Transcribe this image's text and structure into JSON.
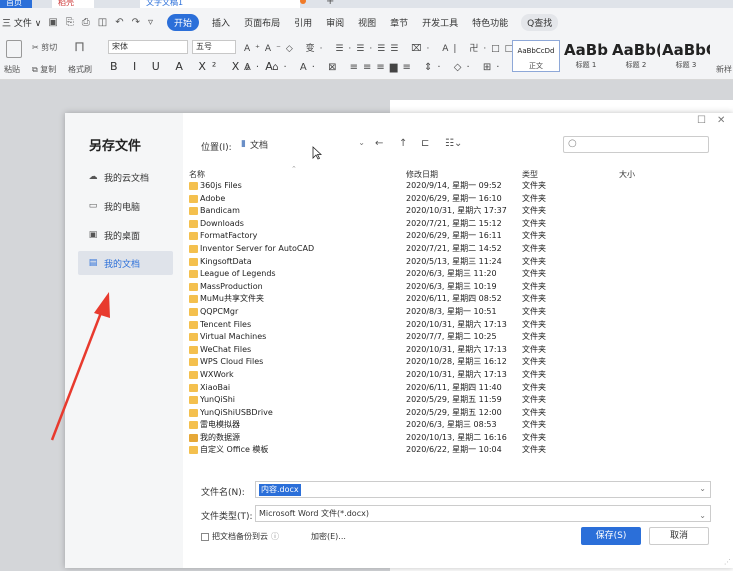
{
  "tabs": {
    "home": "首页",
    "straw": "稻壳",
    "doc": "文字文稿1"
  },
  "menubar": {
    "file": "三 文件 ∨",
    "start": "开始",
    "items": [
      "插入",
      "页面布局",
      "引用",
      "审阅",
      "视图",
      "章节",
      "开发工具",
      "特色功能"
    ],
    "search": "Q查找"
  },
  "ribbon": {
    "cut": "剪切",
    "paste": "粘贴",
    "copy": "复制",
    "format_painter": "格式刷",
    "font_name": "宋体",
    "font_size": "五号",
    "format_row": "B I U A X² X₂ A",
    "styles": [
      {
        "preview": "AaBbCcDd",
        "name": "正文"
      },
      {
        "preview": "AaBb",
        "name": "标题 1"
      },
      {
        "preview": "AaBb(",
        "name": "标题 2"
      },
      {
        "preview": "AaBbC",
        "name": "标题 3"
      }
    ],
    "new_style": "新样"
  },
  "dialog": {
    "title": "另存文件",
    "sidebar": [
      {
        "icon": "cloud-icon",
        "glyph": "☁",
        "label": "我的云文档"
      },
      {
        "icon": "computer-icon",
        "glyph": "▭",
        "label": "我的电脑"
      },
      {
        "icon": "desktop-icon",
        "glyph": "▣",
        "label": "我的桌面"
      },
      {
        "icon": "documents-icon",
        "glyph": "▤",
        "label": "我的文档",
        "active": true
      }
    ],
    "location_label": "位置(I):",
    "location_value": "文档",
    "search_placeholder": "",
    "columns": {
      "name": "名称",
      "modified": "修改日期",
      "type": "类型",
      "size": "大小"
    },
    "files": [
      {
        "name": "360js Files",
        "date": "2020/9/14, 星期一 09:52",
        "type": "文件夹"
      },
      {
        "name": "Adobe",
        "date": "2020/6/29, 星期一 16:10",
        "type": "文件夹"
      },
      {
        "name": "Bandicam",
        "date": "2020/10/31, 星期六 17:37",
        "type": "文件夹"
      },
      {
        "name": "Downloads",
        "date": "2020/7/21, 星期二 15:12",
        "type": "文件夹"
      },
      {
        "name": "FormatFactory",
        "date": "2020/6/29, 星期一 16:11",
        "type": "文件夹"
      },
      {
        "name": "Inventor Server for AutoCAD",
        "date": "2020/7/21, 星期二 14:52",
        "type": "文件夹"
      },
      {
        "name": "KingsoftData",
        "date": "2020/5/13, 星期三 11:24",
        "type": "文件夹"
      },
      {
        "name": "League of Legends",
        "date": "2020/6/3, 星期三 11:20",
        "type": "文件夹"
      },
      {
        "name": "MassProduction",
        "date": "2020/6/3, 星期三 10:19",
        "type": "文件夹"
      },
      {
        "name": "MuMu共享文件夹",
        "date": "2020/6/11, 星期四 08:52",
        "type": "文件夹"
      },
      {
        "name": "QQPCMgr",
        "date": "2020/8/3, 星期一 10:51",
        "type": "文件夹"
      },
      {
        "name": "Tencent Files",
        "date": "2020/10/31, 星期六 17:13",
        "type": "文件夹"
      },
      {
        "name": "Virtual Machines",
        "date": "2020/7/7, 星期二 10:25",
        "type": "文件夹"
      },
      {
        "name": "WeChat Files",
        "date": "2020/10/31, 星期六 17:13",
        "type": "文件夹"
      },
      {
        "name": "WPS Cloud Files",
        "date": "2020/10/28, 星期三 16:12",
        "type": "文件夹"
      },
      {
        "name": "WXWork",
        "date": "2020/10/31, 星期六 17:13",
        "type": "文件夹"
      },
      {
        "name": "XiaoBai",
        "date": "2020/6/11, 星期四 11:40",
        "type": "文件夹"
      },
      {
        "name": "YunQiShi",
        "date": "2020/5/29, 星期五 11:59",
        "type": "文件夹"
      },
      {
        "name": "YunQiShiUSBDrive",
        "date": "2020/5/29, 星期五 12:00",
        "type": "文件夹"
      },
      {
        "name": "雷电模拟器",
        "date": "2020/6/3, 星期三 08:53",
        "type": "文件夹"
      },
      {
        "name": "我的数据源",
        "date": "2020/10/13, 星期二 16:16",
        "type": "文件夹",
        "special": true
      },
      {
        "name": "自定义 Office 模板",
        "date": "2020/6/22, 星期一 10:04",
        "type": "文件夹"
      }
    ],
    "filename_label": "文件名(N):",
    "filename_value": "内容.docx",
    "filetype_label": "文件类型(T):",
    "filetype_value": "Microsoft Word 文件(*.docx)",
    "backup_label": "把文档备份到云",
    "encrypt_label": "加密(E)...",
    "save_label": "保存(S)",
    "cancel_label": "取消"
  },
  "colors": {
    "accent": "#2b6fd9",
    "folder": "#f4c04e",
    "arrow": "#e83a2e"
  }
}
